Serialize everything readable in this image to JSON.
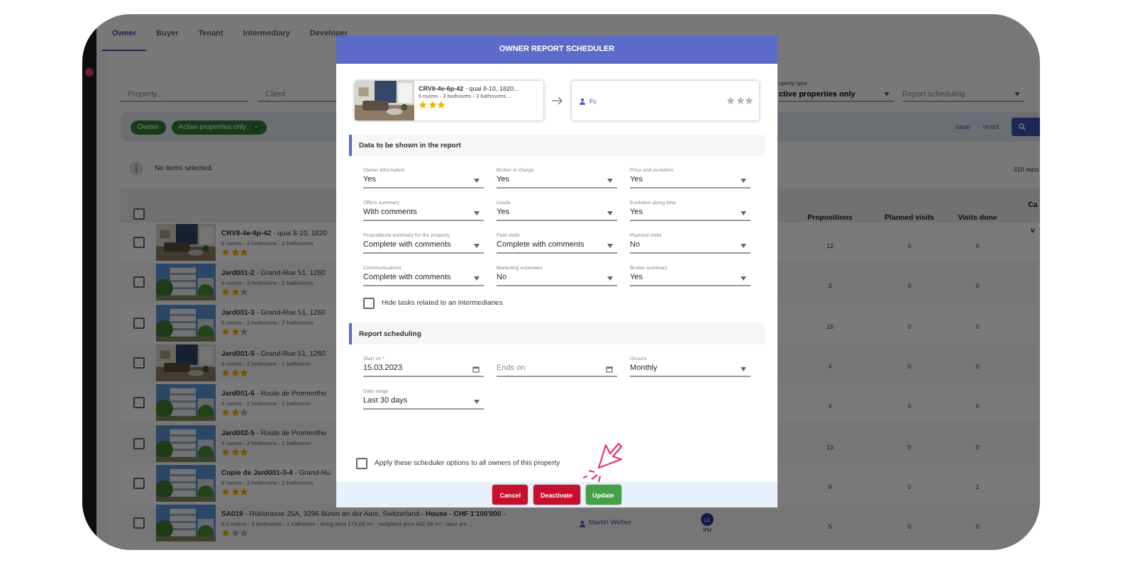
{
  "tabs": [
    {
      "label": "Owner",
      "selected": true
    },
    {
      "label": "Buyer",
      "selected": false
    },
    {
      "label": "Tenant",
      "selected": false
    },
    {
      "label": "Intermediary",
      "selected": false
    },
    {
      "label": "Developer",
      "selected": false
    }
  ],
  "filters": {
    "property": {
      "placeholder": "Property..."
    },
    "client": {
      "placeholder": "Client"
    },
    "property_type": {
      "label": "operty type",
      "value": "ctive properties only"
    },
    "report_scheduling": {
      "placeholder": "Report scheduling"
    }
  },
  "chips": [
    {
      "label": "Owner",
      "removable": false
    },
    {
      "label": "Active properties only",
      "removable": true
    }
  ],
  "actions": {
    "save": "save",
    "reset": "reset"
  },
  "selection": "No items selected.",
  "result_count": "310 repo",
  "table": {
    "header_checked": false,
    "columns": [
      "Propositions",
      "Planned visits",
      "Visits done",
      "Ca\nv"
    ],
    "rows": [
      {
        "title": "**CRV8-4e-6p-42** - quai 8-10, 1820",
        "details": "6 rooms - 3 bedrooms - 3 bathrooms",
        "stars": 3,
        "checked": false,
        "cells": [
          "12",
          "0",
          "0"
        ]
      },
      {
        "title": "**Jard001-2** - Grand-Rue 51, 1260",
        "details": "6 rooms - 3 bedrooms - 2 bathrooms",
        "stars": 2,
        "checked": false,
        "cells": [
          "3",
          "0",
          "0"
        ]
      },
      {
        "title": "**Jard001-3** - Grand-Rue 51, 1260",
        "details": "6 rooms - 3 bedrooms - 2 bathrooms",
        "stars": 2,
        "checked": false,
        "cells": [
          "18",
          "0",
          "0"
        ]
      },
      {
        "title": "**Jard001-5** - Grand-Rue 51, 1260",
        "details": "4 rooms - 2 bedrooms - 1 bathroom",
        "stars": 3,
        "checked": false,
        "cells": [
          "4",
          "0",
          "0"
        ]
      },
      {
        "title": "**Jard001-6** - Route de Promentho",
        "details": "4 rooms - 2 bedrooms - 1 bathroom",
        "stars": 2,
        "checked": false,
        "cells": [
          "4",
          "0",
          "0"
        ]
      },
      {
        "title": "**Jard002-5** - Route de Promentho",
        "details": "4 rooms - 2 bedrooms - 1 bathroom",
        "stars": 3,
        "checked": false,
        "cells": [
          "13",
          "0",
          "0"
        ]
      },
      {
        "title": "**Copie de Jard001-3-4** - Grand-Ru",
        "details": "6 rooms - 3 bedrooms - 2 bathrooms",
        "stars": 3,
        "checked": false,
        "cells": [
          "9",
          "0",
          "1"
        ]
      },
      {
        "title": "**SA019** - Rütistrasse 25A, 3296 Büren an der Aare, Switzerland - **House** - **CHF 1'100'000** -",
        "details": "6.5 rooms - 5 bedrooms - 1 bathroom - living area 179.68 m² - weighted area 432.48 m² - land are...",
        "stars": 1,
        "checked": false,
        "agent": "Martin Weber",
        "avatar": {
          "initials": "LC",
          "caption": "Inv"
        },
        "cells": [
          "5",
          "0",
          "0"
        ]
      }
    ]
  },
  "modal": {
    "title": "OWNER REPORT SCHEDULER",
    "property_card": {
      "title": "**CRV8-4e-6p-42** - quai 8-10, 1820...",
      "details": "6 rooms - 3 bedrooms - 3 bathrooms...",
      "stars": 3
    },
    "owner_card": {
      "name": "Fc",
      "stars": 0
    },
    "sections": [
      {
        "title": "Data to be shown in the report",
        "fields": [
          {
            "kind": "select",
            "label": "Owner information",
            "value": "Yes"
          },
          {
            "kind": "select",
            "label": "Broker in charge",
            "value": "Yes"
          },
          {
            "kind": "select",
            "label": "Price and evolution",
            "value": "Yes"
          },
          {
            "kind": "select",
            "label": "Offers summary",
            "value": "With comments"
          },
          {
            "kind": "select",
            "label": "Leads",
            "value": "Yes"
          },
          {
            "kind": "select",
            "label": "Evolution along time",
            "value": "Yes"
          },
          {
            "kind": "select",
            "label": "Propositions summary for the property",
            "value": "Complete with comments"
          },
          {
            "kind": "select",
            "label": "Past visits",
            "value": "Complete with comments"
          },
          {
            "kind": "select",
            "label": "Planned visits",
            "value": "No"
          },
          {
            "kind": "select",
            "label": "Communications",
            "value": "Complete with comments"
          },
          {
            "kind": "select",
            "label": "Marketing expenses",
            "value": "No"
          },
          {
            "kind": "select",
            "label": "Broker summary",
            "value": "Yes"
          }
        ],
        "checkbox": {
          "label": "Hide tasks related to an intermediaries",
          "checked": false
        }
      },
      {
        "title": "Report scheduling",
        "fields": [
          {
            "kind": "date",
            "label": "Start on *",
            "value": "15.03.2023"
          },
          {
            "kind": "date",
            "placeholder": "Ends on"
          },
          {
            "kind": "select",
            "label": "Occurs",
            "value": "Monthly"
          },
          {
            "kind": "select",
            "label": "Date range",
            "value": "Last 30 days"
          }
        ]
      }
    ],
    "apply_checkbox": {
      "label": "Apply these scheduler options to all owners of this property",
      "checked": false
    },
    "buttons": [
      {
        "label": "Cancel",
        "kind": "danger"
      },
      {
        "label": "Deactivate",
        "kind": "danger"
      },
      {
        "label": "Update",
        "kind": "success"
      }
    ]
  }
}
